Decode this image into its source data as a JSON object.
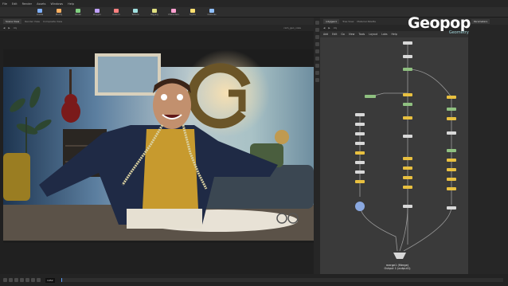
{
  "menu": {
    "items": [
      "File",
      "Edit",
      "Render",
      "Assets",
      "Windows",
      "Help"
    ]
  },
  "shelf": {
    "tools": [
      {
        "label": "Create",
        "color": "#7fb0ff"
      },
      {
        "label": "Modify",
        "color": "#ffb060"
      },
      {
        "label": "Model",
        "color": "#80d080"
      },
      {
        "label": "Polygon",
        "color": "#c0a0ff"
      },
      {
        "label": "Deform",
        "color": "#ff8080"
      },
      {
        "label": "Texture",
        "color": "#a0e0e0"
      },
      {
        "label": "Rigging",
        "color": "#e0e080"
      },
      {
        "label": "Characters",
        "color": "#ffa0d0"
      },
      {
        "label": "Lights",
        "color": "#ffe070"
      },
      {
        "label": "Cameras",
        "color": "#90c0ff"
      }
    ]
  },
  "viewer": {
    "tabs": [
      "Scene View",
      "Render View",
      "Composite View"
    ],
    "path": "obj",
    "camera_label": "cam_geo_view"
  },
  "network": {
    "tabs": [
      "/obj/geo1",
      "Tree View",
      "Material Palette"
    ],
    "menu": [
      "Add",
      "Edit",
      "Go",
      "View",
      "Tools",
      "Layout",
      "Labs",
      "Help"
    ],
    "path": "obj",
    "merge_node_label": "merge1 (Merge)",
    "merge_output_label": "Output 1 (output1)"
  },
  "side_pane": {
    "title": "Parameters",
    "subtitle": "Geometry"
  },
  "logo": {
    "text": "Geopop",
    "sub": "Geometry"
  },
  "playbar": {
    "frame": "1452"
  },
  "colors": {
    "node_yellow": "#e8c040",
    "node_green": "#8fc080",
    "node_white": "#d8d8d8",
    "node_teal": "#70c0b0",
    "wire": "#9a9a9a",
    "accent": "#5aa0ff"
  }
}
